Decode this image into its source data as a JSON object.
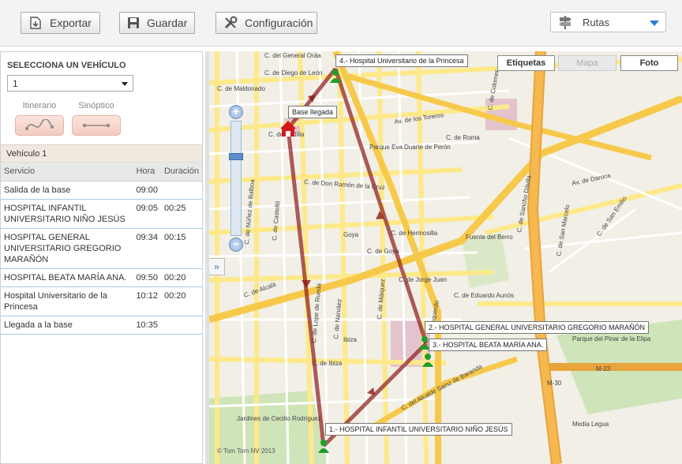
{
  "toolbar": {
    "export_label": "Exportar",
    "save_label": "Guardar",
    "config_label": "Configuración",
    "routes_label": "Rutas"
  },
  "vehicle_selector": {
    "title": "SELECCIONA UN VEHÍCULO",
    "value": "1"
  },
  "modes": {
    "itinerary_label": "Itinerario",
    "synoptic_label": "Sinóptico"
  },
  "vehicle_header": "Vehículo 1",
  "table": {
    "columns": [
      "Servicio",
      "Hora",
      "Duración"
    ],
    "rows": [
      {
        "service": "Salida de la base",
        "time": "09:00",
        "duration": ""
      },
      {
        "service": "HOSPITAL INFANTIL UNIVERSITARIO NIÑO JESÚS",
        "time": "09:05",
        "duration": "00:25"
      },
      {
        "service": "HOSPITAL GENERAL UNIVERSITARIO GREGORIO MARAÑÓN",
        "time": "09:34",
        "duration": "00:15"
      },
      {
        "service": "HOSPITAL BEATA MARÍA ANA.",
        "time": "09:50",
        "duration": "00:20"
      },
      {
        "service": "Hospital Universitario de la Princesa",
        "time": "10:12",
        "duration": "00:20"
      },
      {
        "service": "Llegada a la base",
        "time": "10:35",
        "duration": ""
      }
    ]
  },
  "map": {
    "tabs": [
      "Etiquetas",
      "Mapa",
      "Foto"
    ],
    "copyright": "© Tom Tom NV 2013",
    "callouts": {
      "base": "Base llegada",
      "stop1": "1.- HOSPITAL INFANTIL UNIVERSITARIO NIÑO JESÚS",
      "stop2": "2.- HOSPITAL GENERAL UNIVERSITARIO GREGORIO MARAÑÓN",
      "stop3": "3.- HOSPITAL BEATA MARÍA ANA.",
      "stop4": "4.- Hospital Universitario de la Princesa"
    },
    "streets": {
      "s1": "C. del General Oráa",
      "s2": "C. de Diego de León",
      "s3": "C. de Maldonado",
      "s4": "Av. de los Toreros",
      "s5": "C. de Roma",
      "s6": "Parque Eva Duarte de Perón",
      "s7": "C. de Don Ramón de la Cruz",
      "s8": "C. de Hermosilla",
      "s9": "C. de Goya",
      "s10": "C. de Jorge Juan",
      "s11": "C. de Eduardo Aunós",
      "s12": "C. de Ibiza",
      "s13": "C. del Alcalde Sainz de Baranda",
      "s14": "Jardines de Cecilio Rodríguez",
      "s15": "Av. de Daroca",
      "s16": "Parque del Pinar de la Elipa",
      "s17": "Media Legua",
      "s18": "Fuente del Berro",
      "s19": "M-30",
      "s20": "M-23",
      "s21": "C. de Alcalá",
      "s22": "Goya",
      "s23": "Ibiza",
      "s24": "C. de San Emilio",
      "s25": "C. de San Marcelo",
      "s26": "C. de Núñez de Balboa",
      "s27": "C. de Castelló",
      "s28": "C. de Lope de Rueda",
      "s29": "C. de Narváez",
      "s30": "C. de Máiquez",
      "s31": "C. de Padilla",
      "s32": "C. de Sancho Dávila",
      "s33": "C. de Colomer",
      "s34": "Esquerdo"
    },
    "colors": {
      "route": "#8b1a1a",
      "marker": "#1f9e2a",
      "base": "#d21a1a",
      "road": "#fde98a",
      "highway": "#f7c94b"
    }
  }
}
